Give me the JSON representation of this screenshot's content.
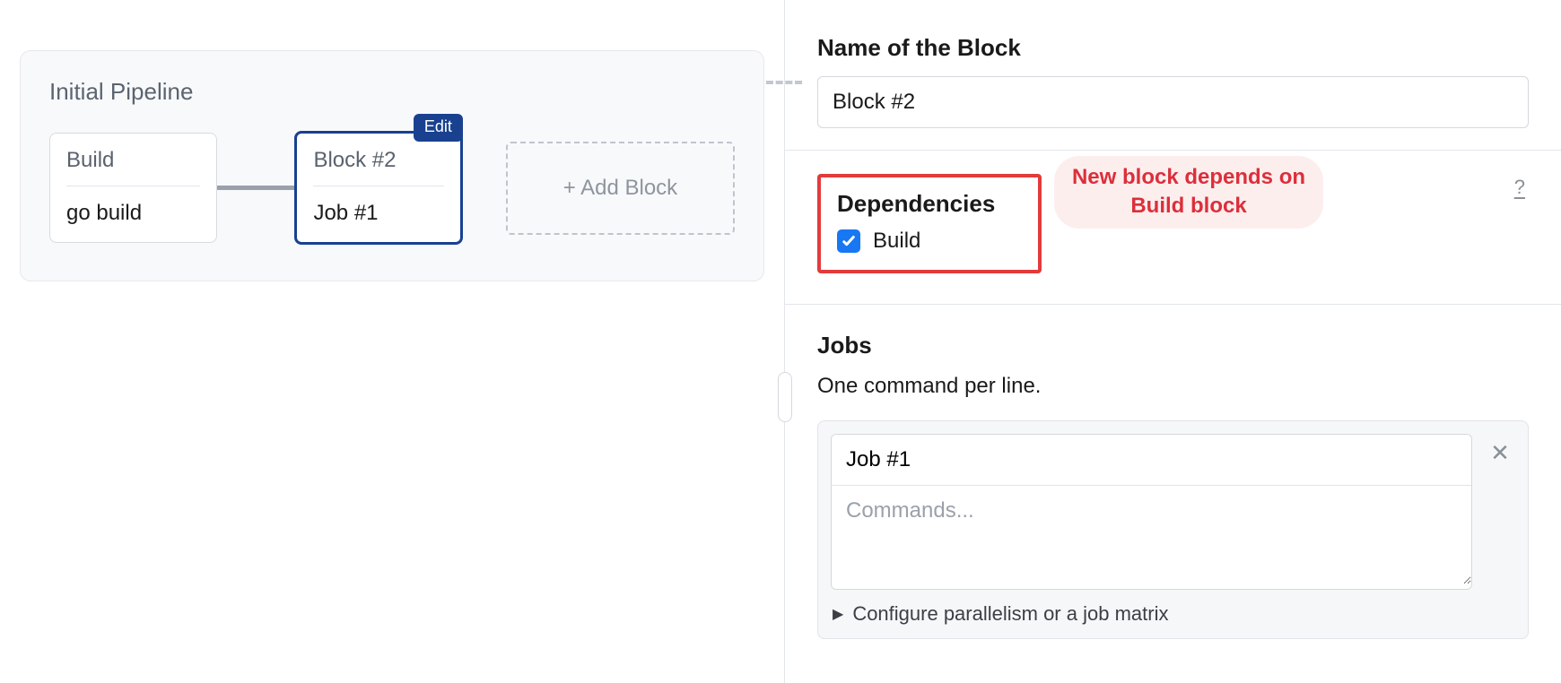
{
  "pipeline": {
    "title": "Initial Pipeline",
    "blocks": [
      {
        "name": "Build",
        "job": "go build"
      },
      {
        "name": "Block #2",
        "job": "Job #1"
      }
    ],
    "add_block_label": "+ Add Block",
    "edit_badge": "Edit"
  },
  "panel": {
    "name_section": {
      "heading": "Name of the Block",
      "value": "Block #2"
    },
    "deps_section": {
      "heading": "Dependencies",
      "items": [
        {
          "label": "Build",
          "checked": true
        }
      ],
      "annotation": "New block depends on Build block",
      "help": "?"
    },
    "jobs_section": {
      "heading": "Jobs",
      "subtext": "One command per line.",
      "job_name": "Job #1",
      "commands_placeholder": "Commands...",
      "parallel_label": "Configure parallelism or a job matrix"
    }
  }
}
